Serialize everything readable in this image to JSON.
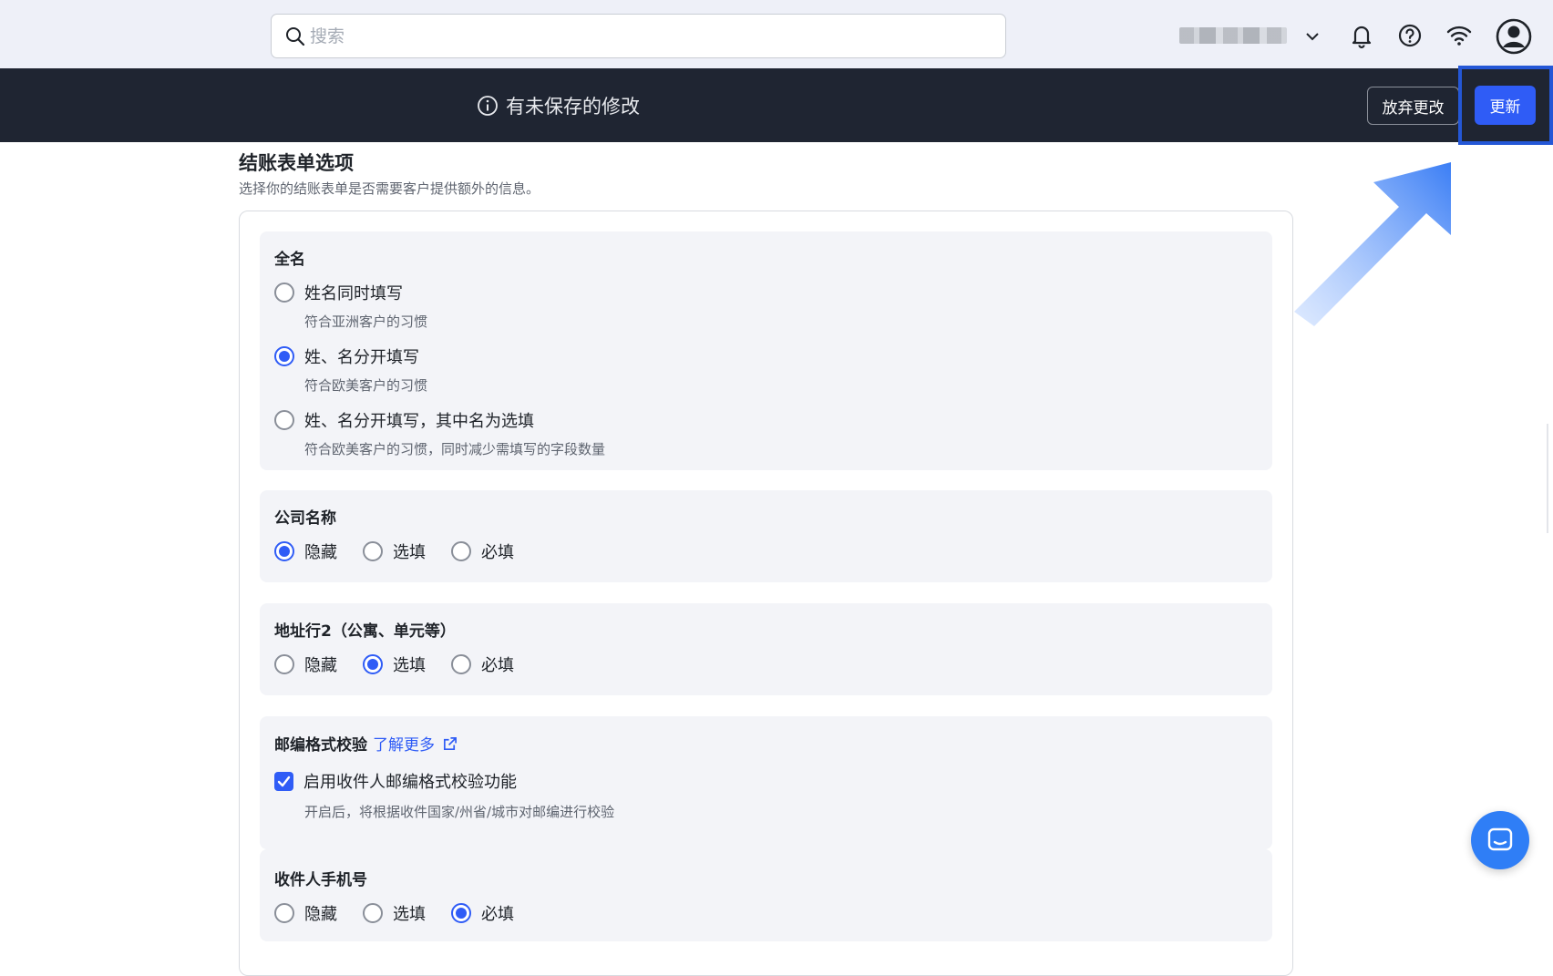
{
  "topbar": {
    "search_placeholder": "搜索",
    "icons": [
      "search-icon",
      "chevron-down-icon",
      "bell-icon",
      "help-icon",
      "wifi-icon",
      "user-avatar-icon"
    ]
  },
  "savebar": {
    "message": "有未保存的修改",
    "discard_label": "放弃更改",
    "update_label": "更新"
  },
  "section": {
    "title": "结账表单选项",
    "description": "选择你的结账表单是否需要客户提供额外的信息。"
  },
  "full_name": {
    "title": "全名",
    "options": [
      {
        "label": "姓名同时填写",
        "sub": "符合亚洲客户的习惯",
        "selected": false
      },
      {
        "label": "姓、名分开填写",
        "sub": "符合欧美客户的习惯",
        "selected": true
      },
      {
        "label": "姓、名分开填写，其中名为选填",
        "sub": "符合欧美客户的习惯，同时减少需填写的字段数量",
        "selected": false
      }
    ]
  },
  "company": {
    "title": "公司名称",
    "options": [
      {
        "label": "隐藏",
        "selected": true
      },
      {
        "label": "选填",
        "selected": false
      },
      {
        "label": "必填",
        "selected": false
      }
    ]
  },
  "address2": {
    "title": "地址行2（公寓、单元等）",
    "options": [
      {
        "label": "隐藏",
        "selected": false
      },
      {
        "label": "选填",
        "selected": true
      },
      {
        "label": "必填",
        "selected": false
      }
    ]
  },
  "zip": {
    "title": "邮编格式校验",
    "link": "了解更多",
    "checkbox_label": "启用收件人邮编格式校验功能",
    "checkbox_sub": "开启后，将根据收件国家/州省/城市对邮编进行校验",
    "checked": true
  },
  "phone": {
    "title": "收件人手机号",
    "options": [
      {
        "label": "隐藏",
        "selected": false
      },
      {
        "label": "选填",
        "selected": false
      },
      {
        "label": "必填",
        "selected": true
      }
    ]
  },
  "colors": {
    "accent": "#2f5cf6",
    "savebar_bg": "#1f2532",
    "topbar_bg": "#eef0f8",
    "group_bg": "#f3f4f8"
  }
}
